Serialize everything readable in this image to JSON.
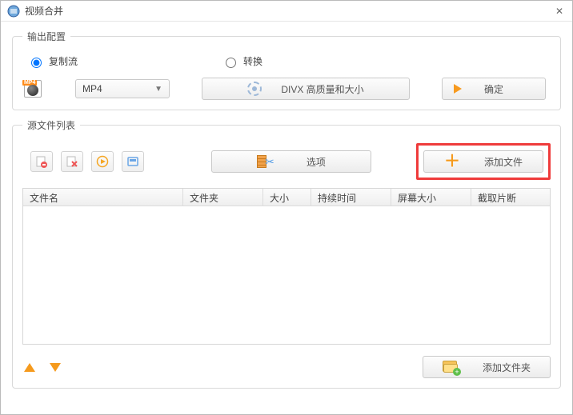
{
  "window": {
    "title": "视频合并"
  },
  "output": {
    "legend": "输出配置",
    "radio_copy": "复制流",
    "radio_convert": "转换",
    "format_tag": "MP4",
    "dropdown_value": "MP4",
    "divx_label": "DIVX 高质量和大小",
    "confirm_label": "确定"
  },
  "source": {
    "legend": "源文件列表",
    "options_label": "选项",
    "addfile_label": "添加文件",
    "addfolder_label": "添加文件夹",
    "columns": {
      "c0": "文件名",
      "c1": "文件夹",
      "c2": "大小",
      "c3": "持续时间",
      "c4": "屏幕大小",
      "c5": "截取片断"
    }
  }
}
